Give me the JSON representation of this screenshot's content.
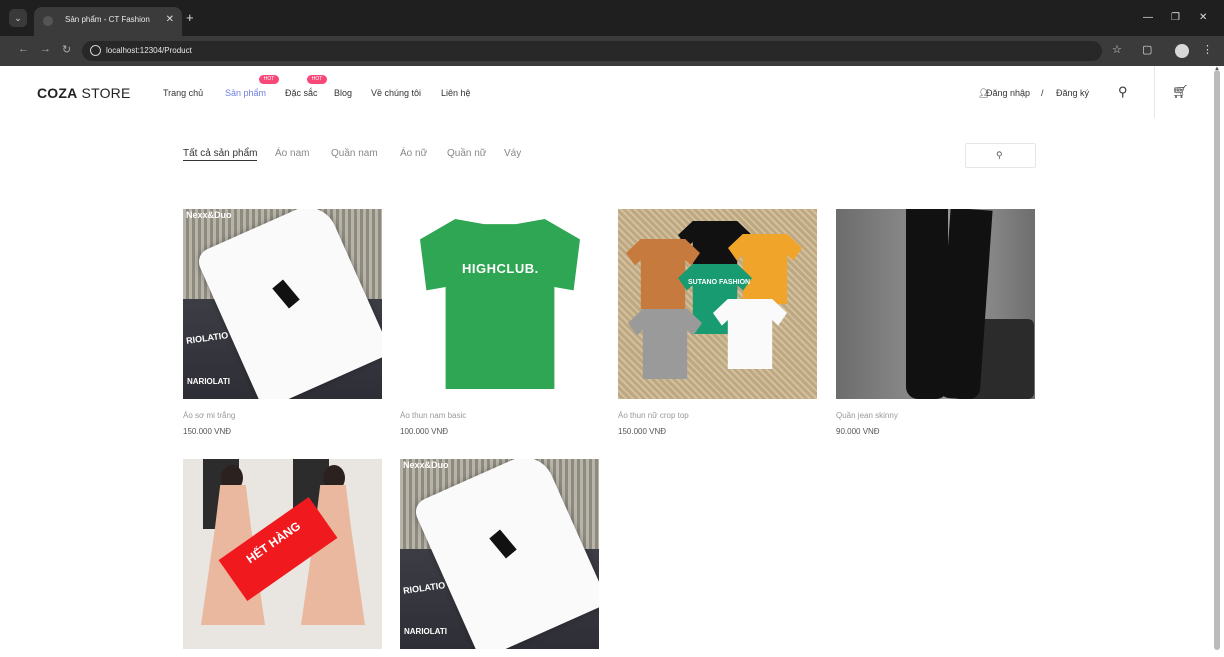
{
  "browser": {
    "tab_title": "Sản phẩm - CT Fashion",
    "url": "localhost:12304/Product"
  },
  "header": {
    "logo_bold": "COZA",
    "logo_rest": " STORE",
    "nav": [
      {
        "label": "Trang chủ"
      },
      {
        "label": "Sản phẩm",
        "badge": "HOT"
      },
      {
        "label": "Đặc sắc",
        "badge": "HOT"
      },
      {
        "label": "Blog"
      },
      {
        "label": "Về chúng tôi"
      },
      {
        "label": "Liên hệ"
      }
    ],
    "login": "Đăng nhập",
    "separator": "/",
    "register": "Đăng ký"
  },
  "filters": [
    {
      "label": "Tất cả sản phẩm"
    },
    {
      "label": "Áo nam"
    },
    {
      "label": "Quần nam"
    },
    {
      "label": "Áo nữ"
    },
    {
      "label": "Quần nữ"
    },
    {
      "label": "Váy"
    }
  ],
  "products": [
    {
      "name": "Áo sơ mi trắng",
      "price": "150.000 VNĐ",
      "image_text": [
        "Nexx&Duo",
        "RIOLATIO",
        "NARIOLATI"
      ]
    },
    {
      "name": "Áo thun nam basic",
      "price": "100.000 VNĐ",
      "image_text": [
        "HIGHCLUB."
      ]
    },
    {
      "name": "Áo thun nữ crop top",
      "price": "150.000 VNĐ",
      "image_text": [
        "SUTANO FASHION"
      ]
    },
    {
      "name": "Quần jean skinny",
      "price": "90.000 VNĐ"
    },
    {
      "name": "",
      "price": "",
      "sold_out": "HẾT HÀNG"
    },
    {
      "name": "",
      "price": "",
      "image_text": [
        "Nexx&Duo",
        "RIOLATIO",
        "NARIOLATI"
      ]
    }
  ],
  "colors": {
    "accent": "#717fe0",
    "hot_badge": "#f74877",
    "sold_out": "#f0191e"
  }
}
